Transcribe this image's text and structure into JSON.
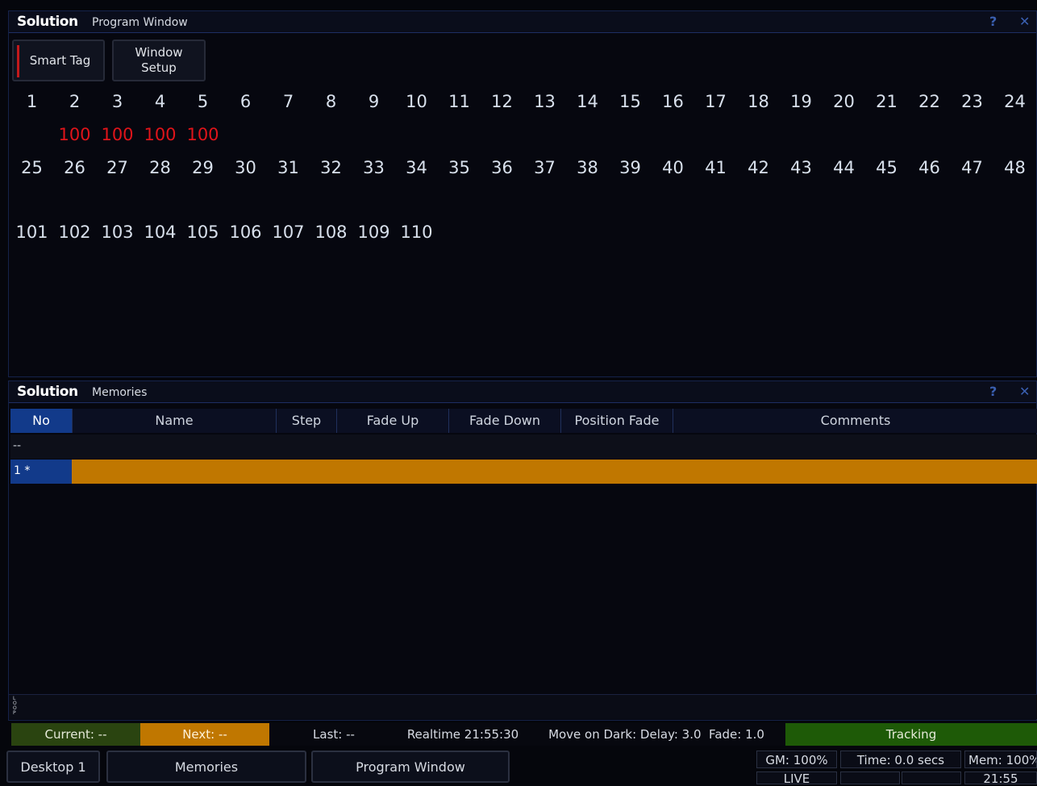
{
  "program_window": {
    "brand": "Solution",
    "title": "Program Window",
    "help": "?",
    "close": "✕",
    "buttons": {
      "smart_tag": "Smart Tag",
      "window_setup_line1": "Window",
      "window_setup_line2": "Setup"
    },
    "channels_row1": [
      "1",
      "2",
      "3",
      "4",
      "5",
      "6",
      "7",
      "8",
      "9",
      "10",
      "11",
      "12",
      "13",
      "14",
      "15",
      "16",
      "17",
      "18",
      "19",
      "20",
      "21",
      "22",
      "23",
      "24"
    ],
    "levels_row1": [
      "",
      "100",
      "100",
      "100",
      "100",
      "",
      "",
      "",
      "",
      "",
      "",
      "",
      "",
      "",
      "",
      "",
      "",
      "",
      "",
      "",
      "",
      "",
      "",
      ""
    ],
    "channels_row2": [
      "25",
      "26",
      "27",
      "28",
      "29",
      "30",
      "31",
      "32",
      "33",
      "34",
      "35",
      "36",
      "37",
      "38",
      "39",
      "40",
      "41",
      "42",
      "43",
      "44",
      "45",
      "46",
      "47",
      "48"
    ],
    "channels_row3": [
      "101",
      "102",
      "103",
      "104",
      "105",
      "106",
      "107",
      "108",
      "109",
      "110"
    ]
  },
  "memories_window": {
    "brand": "Solution",
    "title": "Memories",
    "help": "?",
    "close": "✕",
    "columns": {
      "no": "No",
      "name": "Name",
      "step": "Step",
      "fade_up": "Fade Up",
      "fade_down": "Fade Down",
      "position_fade": "Position Fade",
      "comments": "Comments"
    },
    "rows": [
      {
        "no": "--"
      },
      {
        "no": "1 *"
      }
    ],
    "side_label": "LOOP"
  },
  "status_bar": {
    "current": "Current: --",
    "next": "Next: --",
    "last": "Last: --",
    "realtime": "Realtime 21:55:30",
    "move_on_dark": "Move on Dark: Delay: 3.0  Fade: 1.0",
    "tracking": "Tracking"
  },
  "taskbar": {
    "desktop": "Desktop 1",
    "memories": "Memories",
    "program_window": "Program Window",
    "gm": "GM: 100%",
    "time": "Time: 0.0 secs",
    "mem": "Mem: 100%",
    "live": "LIVE",
    "clock": "21:55"
  },
  "colors": {
    "accent_blue": "#123a8a",
    "amber": "#c07700",
    "tracking_green": "#1e5a07",
    "current_green": "#2a4410",
    "level_red": "#e0141a"
  }
}
